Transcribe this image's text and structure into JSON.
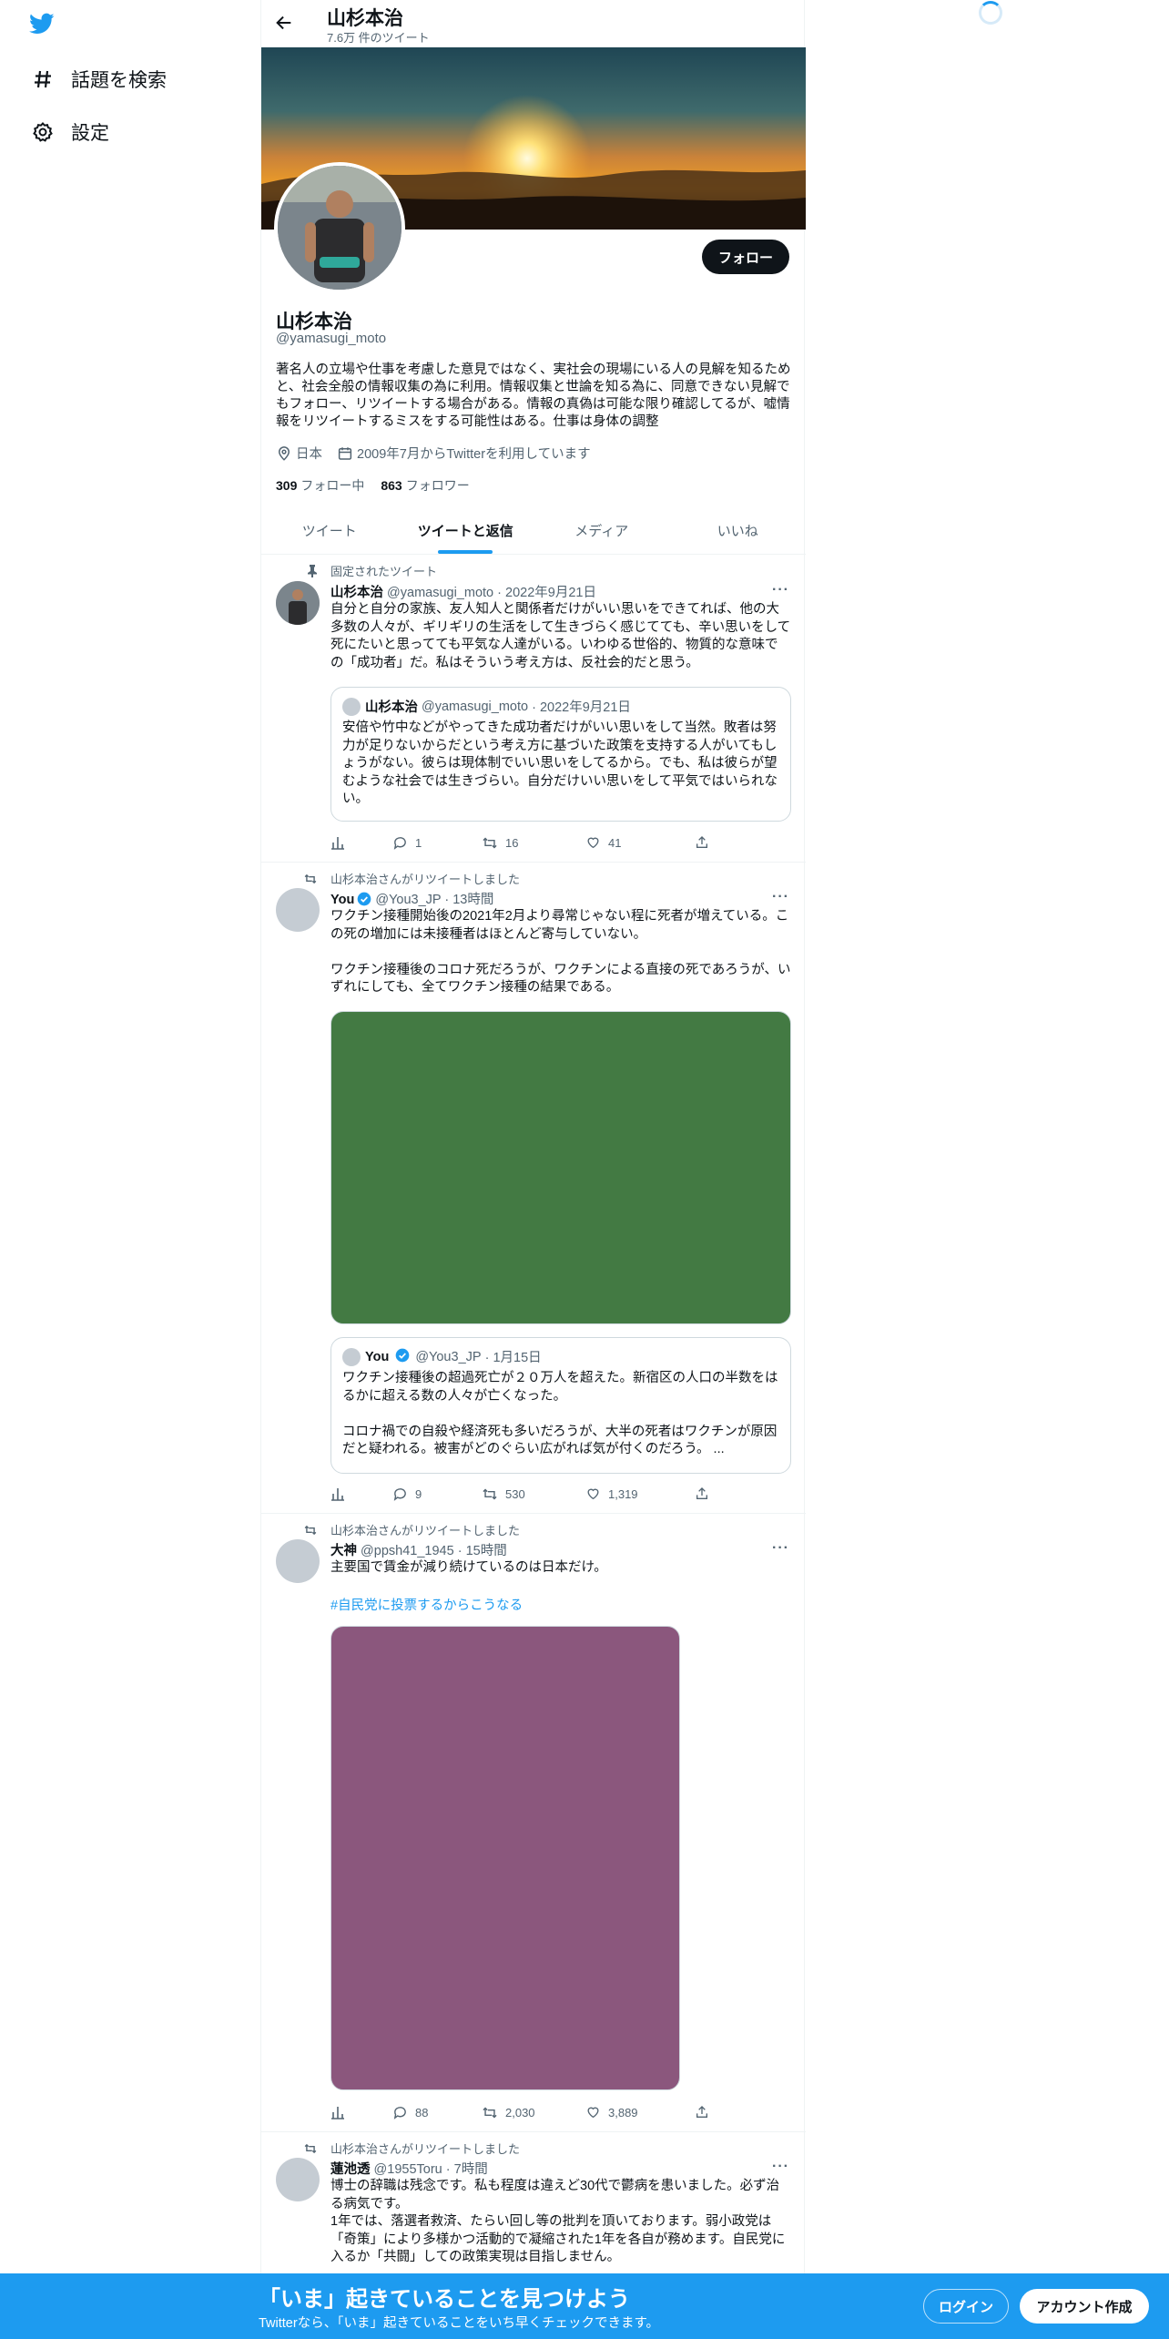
{
  "nav": {
    "logo_icon": "twitter-bird-icon",
    "explore_label": "話題を検索",
    "settings_label": "設定"
  },
  "header": {
    "title": "山杉本治",
    "subtitle": "7.6万 件のツイート"
  },
  "profile": {
    "name": "山杉本治",
    "handle": "@yamasugi_moto",
    "follow_label": "フォロー",
    "bio": "著名人の立場や仕事を考慮した意見ではなく、実社会の現場にいる人の見解を知るためと、社会全般の情報収集の為に利用。情報収集と世論を知る為に、同意できない見解でもフォロー、リツイートする場合がある。情報の真偽は可能な限り確認してるが、嘘情報をリツイートするミスをする可能性はある。仕事は身体の調整",
    "location": "日本",
    "joined": "2009年7月からTwitterを利用しています",
    "following_count": "309",
    "following_label": "フォロー中",
    "followers_count": "863",
    "followers_label": "フォロワー"
  },
  "tabs": [
    {
      "label": "ツイート",
      "active": false
    },
    {
      "label": "ツイートと返信",
      "active": true
    },
    {
      "label": "メディア",
      "active": false
    },
    {
      "label": "いいね",
      "active": false
    }
  ],
  "tweets": [
    {
      "context": "固定されたツイート",
      "name": "山杉本治",
      "handle": "@yamasugi_moto",
      "dot": "·",
      "time": "2022年9月21日",
      "text": "自分と自分の家族、友人知人と関係者だけがいい思いをできてれば、他の大多数の人々が、ギリギリの生活をして生きづらく感じてても、辛い思いをして死にたいと思ってても平気な人達がいる。いわゆる世俗的、物質的な意味での「成功者」だ。私はそういう考え方は、反社会的だと思う。",
      "quote": {
        "name": "山杉本治",
        "handle": "@yamasugi_moto",
        "time": "· 2022年9月21日",
        "text": "安倍や竹中などがやってきた成功者だけがいい思いをして当然。敗者は努力が足りないからだという考え方に基づいた政策を支持する人がいてもしょうがない。彼らは現体制でいい思いをしてるから。でも、私は彼らが望むような社会では生きづらい。自分だけいい思いをして平気ではいられない。"
      },
      "replies": "1",
      "retweets": "16",
      "likes": "41"
    },
    {
      "context": "山杉本治さんがリツイートしました",
      "name": "You",
      "handle": "@You3_JP",
      "dot": "·",
      "time": "13時間",
      "text": "ワクチン接種開始後の2021年2月より尋常じゃない程に死者が増えている。この死の増加には未接種者はほとんど寄与していない。\n\nワクチン接種後のコロナ死だろうが、ワクチンによる直接の死であろうが、いずれにしても、全てワクチン接種の結果である。",
      "media_color": "#437a43",
      "quote": {
        "name": "You",
        "handle": "@You3_JP",
        "time": "· 1月15日",
        "text": "ワクチン接種後の超過死亡が２０万人を超えた。新宿区の人口の半数をはるかに超える数の人々が亡くなった。\n\nコロナ禍での自殺や経済死も多いだろうが、大半の死者はワクチンが原因だと疑われる。被害がどのぐらい広がれば気が付くのだろう。 ..."
      },
      "replies": "9",
      "retweets": "530",
      "likes": "1,319"
    },
    {
      "context": "山杉本治さんがリツイートしました",
      "name": "大神",
      "handle": "@ppsh41_1945",
      "dot": "·",
      "time": "15時間",
      "text": "主要国で賃金が減り続けているのは日本だけ。",
      "hashtag": "#自民党に投票するからこうなる",
      "media_color": "#8b577d",
      "replies": "88",
      "retweets": "2,030",
      "likes": "3,889"
    },
    {
      "context": "山杉本治さんがリツイートしました",
      "name": "蓮池透",
      "handle": "@1955Toru",
      "dot": "·",
      "time": "7時間",
      "text": "博士の辞職は残念です。私も程度は違えど30代で鬱病を患いました。必ず治る病気です。\n1年では、落選者救済、たらい回し等の批判を頂いております。弱小政党は「奇策」により多様かつ活動的で凝縮された1年を各自が務めます。自民党に入るか「共闘」しての政策実現は目指しません。"
    }
  ],
  "bottom_bar": {
    "title": "「いま」起きていることを見つけよう",
    "subtitle": "Twitterなら、「いま」起きていることをいち早くチェックできます。",
    "login_label": "ログイン",
    "signup_label": "アカウント作成"
  }
}
